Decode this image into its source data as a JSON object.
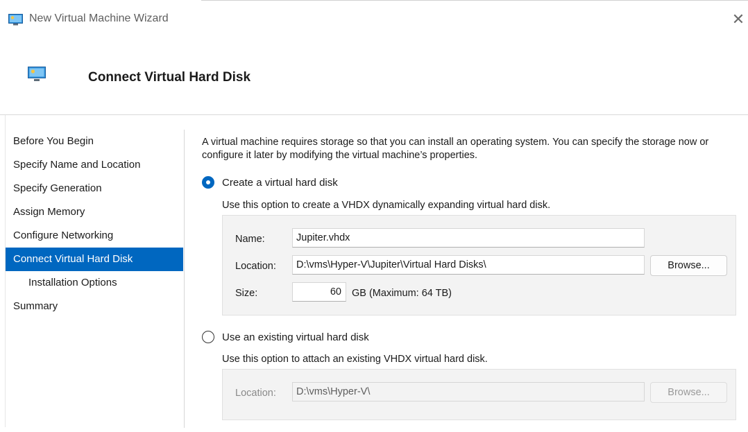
{
  "window": {
    "title": "New Virtual Machine Wizard",
    "close_glyph": "✕"
  },
  "header": {
    "title": "Connect Virtual Hard Disk",
    "icon": "virtual-machine-icon"
  },
  "nav": {
    "items": [
      {
        "label": "Before You Begin"
      },
      {
        "label": "Specify Name and Location"
      },
      {
        "label": "Specify Generation"
      },
      {
        "label": "Assign Memory"
      },
      {
        "label": "Configure Networking"
      },
      {
        "label": "Connect Virtual Hard Disk"
      },
      {
        "label": "Installation Options"
      },
      {
        "label": "Summary"
      }
    ]
  },
  "content": {
    "intro": "A virtual machine requires storage so that you can install an operating system. You can specify the storage now or configure it later by modifying the virtual machine’s properties.",
    "create": {
      "label": "Create a virtual hard disk",
      "description": "Use this option to create a VHDX dynamically expanding virtual hard disk.",
      "name_label": "Name:",
      "name_value": "Jupiter.vhdx",
      "location_label": "Location:",
      "location_value": "D:\\vms\\Hyper-V\\Jupiter\\Virtual Hard Disks\\",
      "browse_label": "Browse...",
      "size_label": "Size:",
      "size_value": "60",
      "size_suffix": "GB (Maximum: 64 TB)"
    },
    "existing": {
      "label": "Use an existing virtual hard disk",
      "description": "Use this option to attach an existing VHDX virtual hard disk.",
      "location_label": "Location:",
      "location_value": "D:\\vms\\Hyper-V\\",
      "browse_label": "Browse..."
    }
  },
  "colors": {
    "accent": "#0067c0",
    "selected_nav_text": "#ffffff",
    "group_bg": "#f3f3f3"
  }
}
